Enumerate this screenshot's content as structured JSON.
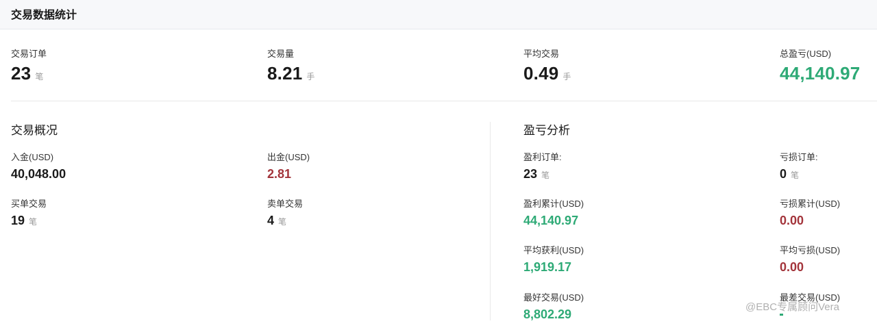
{
  "header": {
    "title": "交易数据统计"
  },
  "summary": {
    "orders": {
      "label": "交易订单",
      "value": "23",
      "unit": "笔"
    },
    "volume": {
      "label": "交易量",
      "value": "8.21",
      "unit": "手"
    },
    "avg": {
      "label": "平均交易",
      "value": "0.49",
      "unit": "手"
    },
    "pnl": {
      "label": "总盈亏(USD)",
      "value": "44,140.97"
    }
  },
  "overview": {
    "title": "交易概况",
    "deposit": {
      "label": "入金(USD)",
      "value": "40,048.00"
    },
    "withdraw": {
      "label": "出金(USD)",
      "value": "2.81"
    },
    "buy": {
      "label": "买单交易",
      "value": "19",
      "unit": "笔"
    },
    "sell": {
      "label": "卖单交易",
      "value": "4",
      "unit": "笔"
    }
  },
  "analysis": {
    "title": "盈亏分析",
    "profit_orders": {
      "label": "盈利订单:",
      "value": "23",
      "unit": "笔"
    },
    "loss_orders": {
      "label": "亏损订单:",
      "value": "0",
      "unit": "笔"
    },
    "profit_total": {
      "label": "盈利累计(USD)",
      "value": "44,140.97"
    },
    "loss_total": {
      "label": "亏损累计(USD)",
      "value": "0.00"
    },
    "avg_profit": {
      "label": "平均获利(USD)",
      "value": "1,919.17"
    },
    "avg_loss": {
      "label": "平均亏损(USD)",
      "value": "0.00"
    },
    "best": {
      "label": "最好交易(USD)",
      "value": "8,802.29"
    },
    "worst": {
      "label": "最差交易(USD)",
      "value": ""
    }
  },
  "watermark": {
    "text": "@EBC专属顾问Vera"
  },
  "colors": {
    "positive": "#2eaa76",
    "negative": "#a3343b"
  }
}
